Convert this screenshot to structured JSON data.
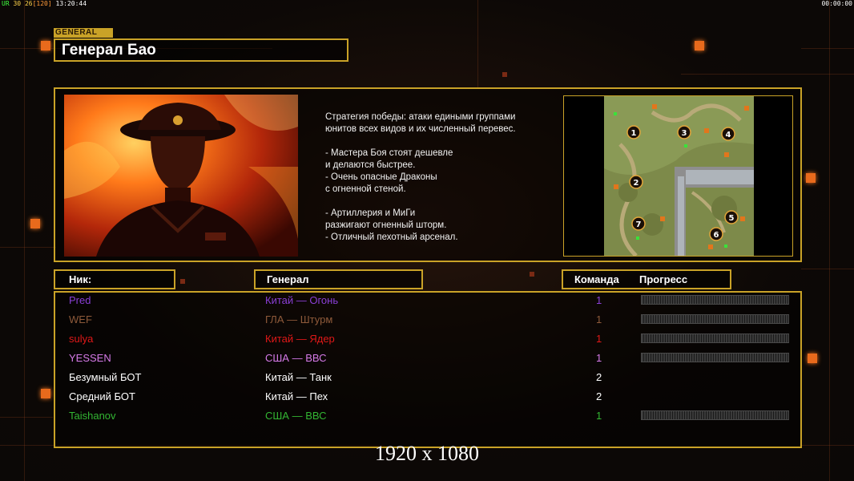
{
  "hud": {
    "left_a": "UR",
    "left_b": "30",
    "left_c": "26",
    "left_d": "[120]",
    "left_time": "13:20:44",
    "right_time": "00:00:00"
  },
  "general": {
    "tag": "GENERAL",
    "name": "Генерал Бао"
  },
  "strategy": {
    "intro": "Стратегия победы: атаки едиными группами\nюнитов всех видов и их численный перевес.",
    "points_a": "- Мастера Боя стоят дешевле\nи делаются быстрее.\n- Очень опасные Драконы\nс огненной стеной.",
    "points_b": "- Артиллерия и МиГи\nразжигают огненный шторм.\n- Отличный пехотный арсенал."
  },
  "map": {
    "slots": [
      "1",
      "2",
      "3",
      "4",
      "5",
      "6",
      "7"
    ]
  },
  "headers": {
    "nick": "Ник:",
    "general": "Генерал",
    "team": "Команда",
    "progress": "Прогресс"
  },
  "players": [
    {
      "name": "Pred",
      "general": "Китай — Огонь",
      "team": "1",
      "color": "#8a3fd6",
      "progress": true
    },
    {
      "name": "WEF",
      "general": "ГЛА — Штурм",
      "team": "1",
      "color": "#8e5a3a",
      "progress": true
    },
    {
      "name": "sulya",
      "general": "Китай — Ядер",
      "team": "1",
      "color": "#e01818",
      "progress": true
    },
    {
      "name": "YESSEN",
      "general": "США — ВВС",
      "team": "1",
      "color": "#d67ae8",
      "progress": true
    },
    {
      "name": "Безумный БОТ",
      "general": "Китай — Танк",
      "team": "2",
      "color": "#ffffff",
      "progress": false
    },
    {
      "name": "Средний БОТ",
      "general": "Китай — Пех",
      "team": "2",
      "color": "#ffffff",
      "progress": false
    },
    {
      "name": "Taishanov",
      "general": "США — ВВС",
      "team": "1",
      "color": "#33b633",
      "progress": true
    }
  ],
  "resolution": "1920 x 1080",
  "colors": {
    "frame": "#c9a227",
    "accent": "#e86a1c"
  }
}
